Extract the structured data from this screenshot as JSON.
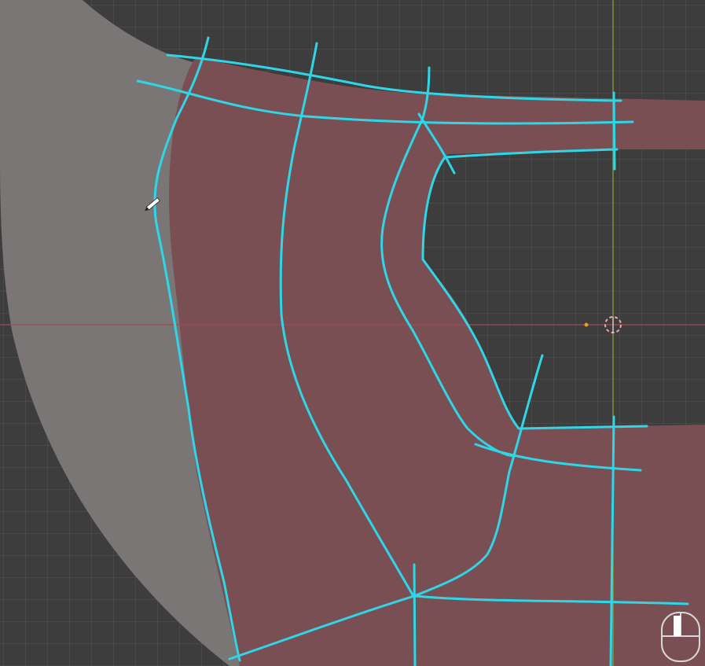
{
  "viewport": {
    "type": "3d-viewport",
    "mode": "draw"
  },
  "colors": {
    "background": "#3d3d3d",
    "reference_surface": "#7a7676",
    "mesh_fill": "#7a4f54",
    "stroke": "#2fd6e6",
    "x_axis": "#a8485a",
    "y_axis": "#8aa53a",
    "cursor_3d": "#e8a8ae"
  },
  "icons": {
    "brush_cursor": "pencil-icon",
    "origin": "3d-cursor-icon",
    "mouse": "mouse-icon"
  }
}
